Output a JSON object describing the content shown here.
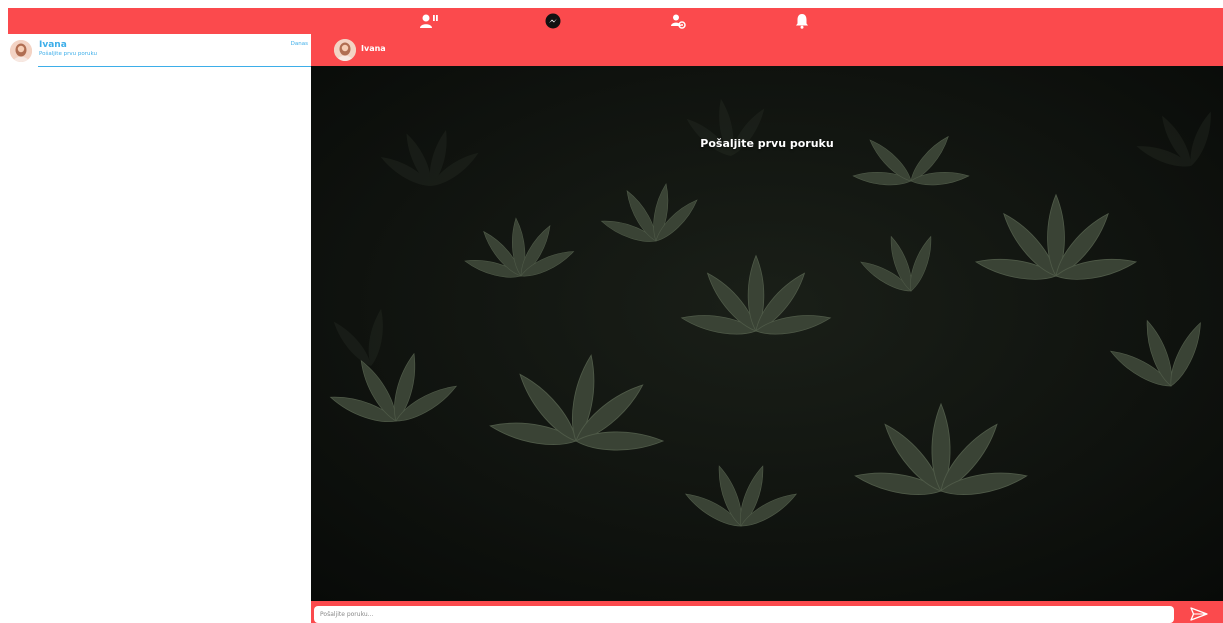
{
  "colors": {
    "primary": "#fb4a4d",
    "accent": "#3daee9"
  },
  "nav": {
    "icons": [
      "friends-icon",
      "messenger-icon",
      "user-settings-icon",
      "bell-icon"
    ]
  },
  "sidebar": {
    "conversations": [
      {
        "name": "Ivana",
        "preview": "Pošaljite prvu poruku",
        "date": "Danas"
      }
    ]
  },
  "chat": {
    "header_name": "Ivana",
    "empty_message": "Pošaljite prvu poruku"
  },
  "composer": {
    "placeholder": "Pošaljite poruku..."
  }
}
